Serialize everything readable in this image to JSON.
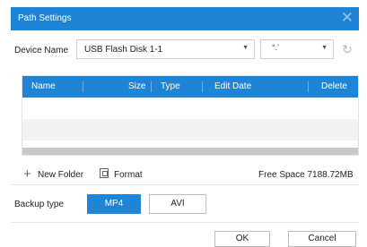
{
  "dialog": {
    "title": "Path Settings",
    "close_glyph": "✕"
  },
  "device": {
    "label": "Device Name",
    "selected": "USB Flash Disk 1-1",
    "partition_selected": "°.'",
    "dropdown_glyph": "▼"
  },
  "table": {
    "columns": [
      "Name",
      "Size",
      "Type",
      "Edit Date",
      "Delete"
    ],
    "rows": []
  },
  "toolbar": {
    "new_folder_label": "New Folder",
    "format_label": "Format",
    "free_space": "Free Space 7188.72MB",
    "plus_glyph": "+",
    "refresh_glyph": "↻"
  },
  "backup": {
    "label": "Backup type",
    "options": [
      "MP4",
      "AVI"
    ],
    "selected": "MP4"
  },
  "footer": {
    "ok_label": "OK",
    "cancel_label": "Cancel"
  },
  "colors": {
    "accent": "#1f84d6",
    "table_alt_row": "#f3f3f3",
    "scrollbar": "#c8c8c8"
  },
  "icons": {
    "close": "close-icon",
    "refresh": "refresh-icon",
    "new_folder": "plus-icon",
    "format": "format-icon",
    "dropdown": "chevron-down-icon"
  }
}
